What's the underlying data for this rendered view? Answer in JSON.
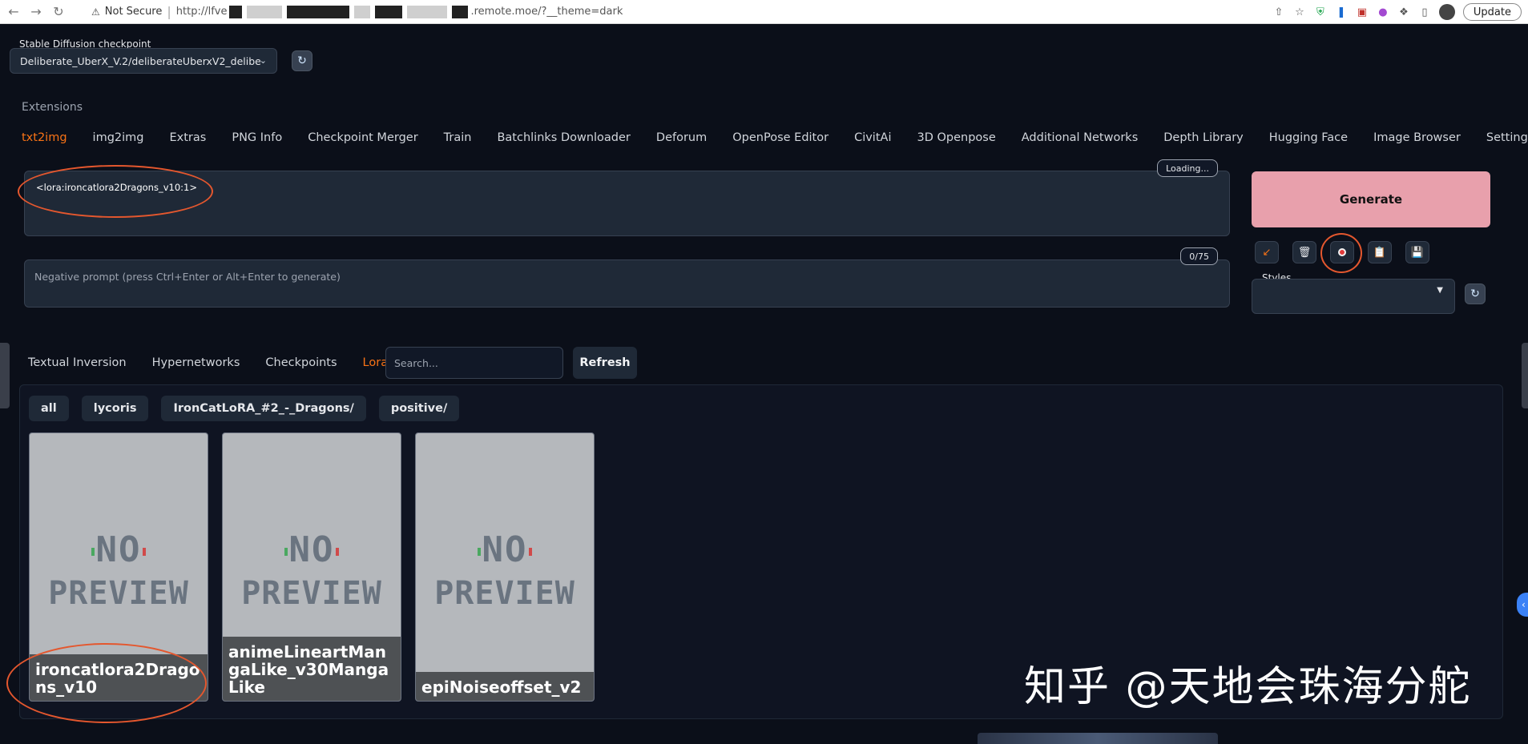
{
  "browser": {
    "security_label": "Not Secure",
    "url_prefix": "http://lfve",
    "url_suffix": ".remote.moe/?__theme=dark",
    "update_label": "Update"
  },
  "checkpoint": {
    "label": "Stable Diffusion checkpoint",
    "value": "Deliberate_UberX_V.2/deliberateUberxV2_delibe"
  },
  "extensions_label": "Extensions",
  "tabs": [
    {
      "label": "txt2img",
      "active": true
    },
    {
      "label": "img2img"
    },
    {
      "label": "Extras"
    },
    {
      "label": "PNG Info"
    },
    {
      "label": "Checkpoint Merger"
    },
    {
      "label": "Train"
    },
    {
      "label": "Batchlinks Downloader"
    },
    {
      "label": "Deforum"
    },
    {
      "label": "OpenPose Editor"
    },
    {
      "label": "CivitAi"
    },
    {
      "label": "3D Openpose"
    },
    {
      "label": "Additional Networks"
    },
    {
      "label": "Depth Library"
    },
    {
      "label": "Hugging Face"
    },
    {
      "label": "Image Browser"
    },
    {
      "label": "Settings"
    }
  ],
  "prompt": {
    "value": "<lora:ironcatlora2Dragons_v10:1>",
    "token_count": "Loading..."
  },
  "negative_prompt": {
    "placeholder": "Negative prompt (press Ctrl+Enter or Alt+Enter to generate)",
    "token_count": "0/75"
  },
  "generate_label": "Generate",
  "styles_label": "Styles",
  "extra_networks": {
    "tabs": [
      {
        "label": "Textual Inversion"
      },
      {
        "label": "Hypernetworks"
      },
      {
        "label": "Checkpoints"
      },
      {
        "label": "Lora",
        "active": true
      }
    ],
    "search_placeholder": "Search...",
    "refresh_label": "Refresh",
    "filters": [
      "all",
      "lycoris",
      "IronCatLoRA_#2_-_Dragons/",
      "positive/"
    ],
    "cards": [
      {
        "name": "ironcatlora2Dragons_v10"
      },
      {
        "name": "animeLineartMangaLike_v30MangaLike"
      },
      {
        "name": "epiNoiseoffset_v2"
      }
    ],
    "no_preview_line1": "NO",
    "no_preview_line2": "PREVIEW"
  },
  "watermark": "知乎 @天地会珠海分舵",
  "icons": {
    "back": "back-arrow-icon",
    "forward": "forward-arrow-icon",
    "reload": "reload-icon",
    "refresh": "refresh-icon",
    "read_params": "arrow-down-left-icon",
    "clear": "trash-icon",
    "show_networks": "red-dot-icon",
    "paste": "clipboard-icon",
    "save": "floppy-disk-icon"
  },
  "colors": {
    "accent": "#f97316",
    "generate": "#e8a0ac",
    "background": "#0b0f19",
    "annotation": "#e4572e"
  }
}
